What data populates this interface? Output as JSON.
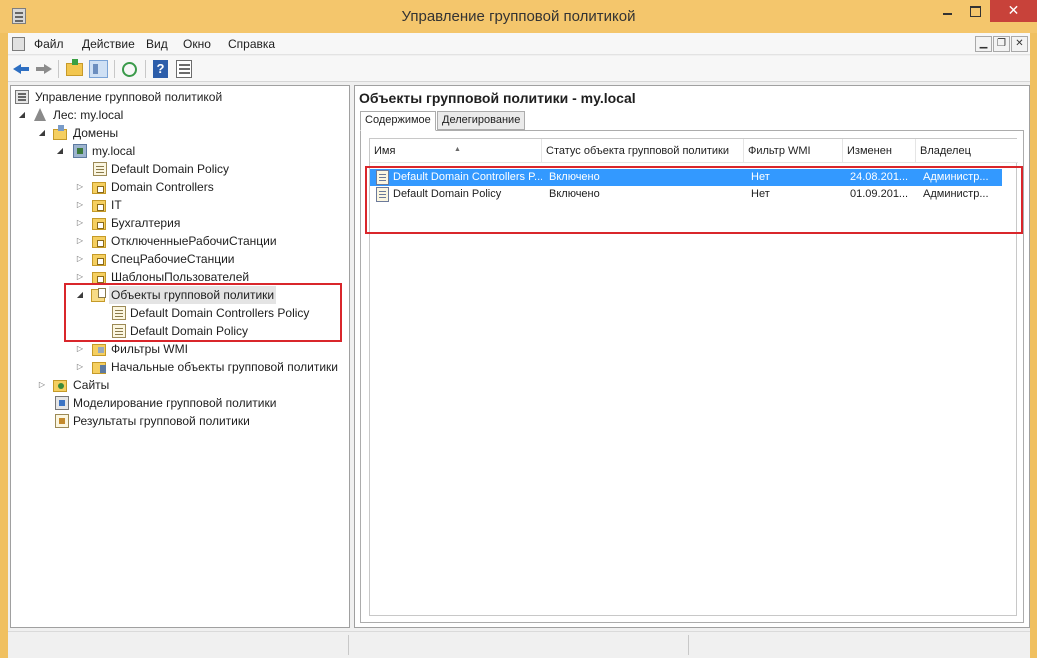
{
  "window": {
    "title": "Управление групповой политикой",
    "close_glyph": "✕"
  },
  "menu": {
    "items": [
      "Файл",
      "Действие",
      "Вид",
      "Окно",
      "Справка"
    ]
  },
  "tree": {
    "root": "Управление групповой политикой",
    "forest": "Лес: my.local",
    "domains": "Домены",
    "domain": "my.local",
    "domain_children": [
      "Default Domain Policy",
      "Domain Controllers",
      "IT",
      "Бухгалтерия",
      "ОтключенныеРабочиСтанции",
      "СпецРабочиеСтанции",
      "ШаблоныПользователей"
    ],
    "gpo_folder": "Объекты групповой политики",
    "gpo_items": [
      "Default Domain Controllers Policy",
      "Default Domain Policy"
    ],
    "wmi_filters": "Фильтры WMI",
    "starter_gpos": "Начальные объекты групповой политики",
    "sites": "Сайты",
    "modeling": "Моделирование групповой политики",
    "results": "Результаты групповой политики"
  },
  "details": {
    "title": "Объекты групповой политики - my.local",
    "tabs": [
      "Содержимое",
      "Делегирование"
    ],
    "columns": [
      "Имя",
      "Статус объекта групповой политики",
      "Фильтр WMI",
      "Изменен",
      "Владелец"
    ],
    "rows": [
      [
        "Default Domain Controllers P...",
        "Включено",
        "Нет",
        "24.08.201...",
        "Администр..."
      ],
      [
        "Default Domain Policy",
        "Включено",
        "Нет",
        "01.09.201...",
        "Администр..."
      ]
    ]
  },
  "icons": {
    "app": "console-icon",
    "back": "back-arrow-icon",
    "forward": "forward-arrow-icon",
    "up": "up-folder-icon",
    "tree_toggle": "show-tree-icon",
    "refresh": "refresh-icon",
    "help": "help-icon",
    "properties": "properties-icon"
  },
  "colors": {
    "titlebar": "#f4c66c",
    "selection": "#3399ff",
    "highlight_box": "#d9262b",
    "close_button": "#c8423a"
  }
}
